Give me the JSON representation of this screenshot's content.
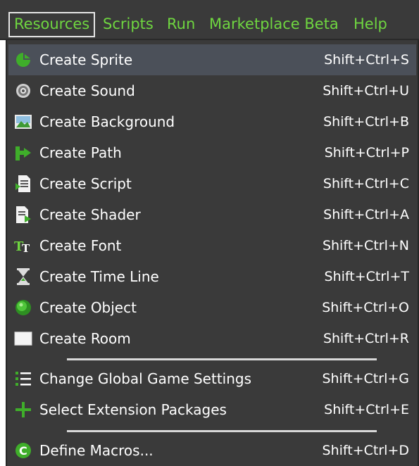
{
  "menubar": {
    "items": [
      {
        "label": "Resources",
        "active": true
      },
      {
        "label": "Scripts"
      },
      {
        "label": "Run"
      },
      {
        "label": "Marketplace Beta"
      },
      {
        "label": "Help"
      }
    ]
  },
  "dropdown": {
    "items": [
      {
        "label": "Create Sprite",
        "shortcut": "Shift+Ctrl+S",
        "icon": "sprite-icon",
        "highlighted": true
      },
      {
        "label": "Create Sound",
        "shortcut": "Shift+Ctrl+U",
        "icon": "sound-icon"
      },
      {
        "label": "Create Background",
        "shortcut": "Shift+Ctrl+B",
        "icon": "background-icon"
      },
      {
        "label": "Create Path",
        "shortcut": "Shift+Ctrl+P",
        "icon": "path-icon"
      },
      {
        "label": "Create Script",
        "shortcut": "Shift+Ctrl+C",
        "icon": "script-icon"
      },
      {
        "label": "Create Shader",
        "shortcut": "Shift+Ctrl+A",
        "icon": "shader-icon"
      },
      {
        "label": "Create Font",
        "shortcut": "Shift+Ctrl+N",
        "icon": "font-icon"
      },
      {
        "label": "Create Time Line",
        "shortcut": "Shift+Ctrl+T",
        "icon": "timeline-icon"
      },
      {
        "label": "Create Object",
        "shortcut": "Shift+Ctrl+O",
        "icon": "object-icon"
      },
      {
        "label": "Create Room",
        "shortcut": "Shift+Ctrl+R",
        "icon": "room-icon"
      },
      {
        "label": "Change Global Game Settings",
        "shortcut": "Shift+Ctrl+G",
        "icon": "settings-list-icon"
      },
      {
        "label": "Select Extension Packages",
        "shortcut": "Shift+Ctrl+E",
        "icon": "plus-icon"
      },
      {
        "label": "Define Macros...",
        "shortcut": "Shift+Ctrl+D",
        "icon": "macro-icon"
      }
    ]
  },
  "colors": {
    "menubar_bg": "#3a3a3a",
    "menu_text": "#6fd640",
    "item_text": "#ffffff",
    "highlight_bg": "#4b5059",
    "separator": "#d8d8d8"
  }
}
